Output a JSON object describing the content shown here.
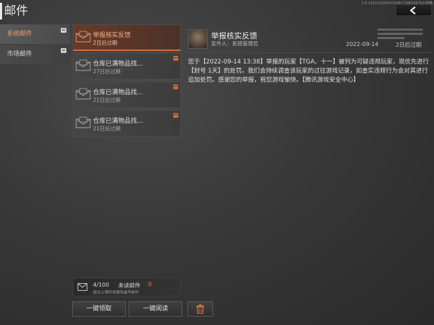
{
  "header": {
    "title": "邮件",
    "version": "1.0.116115(09141548)7186598763)高精"
  },
  "categories": [
    {
      "label": "系统邮件",
      "active": true
    },
    {
      "label": "市场邮件",
      "active": false
    }
  ],
  "mails": [
    {
      "title": "举报核实反馈",
      "expiry": "2日后过期",
      "active": true
    },
    {
      "title": "仓库已满物品找...",
      "expiry": "27日后过期",
      "active": false
    },
    {
      "title": "仓库已满物品找...",
      "expiry": "21日后过期",
      "active": false
    },
    {
      "title": "仓库已满物品找...",
      "expiry": "21日后过期",
      "active": false
    }
  ],
  "detail": {
    "title": "举报核实反馈",
    "sender": "发件人：系统管理员",
    "date": "2022-09-14",
    "expiry": "2日后过期",
    "body": "您于【2022-09-14 13:38】举报的玩家【TGA、十一】被列为可疑违规玩家，现优先进行【封号 1天】的处罚。我们会持续调查该玩家的过往游戏记录，如查实违规行为会对其进行追加处罚。感谢您的举报，祝您游戏愉快。【腾讯游戏安全中心】"
  },
  "footer": {
    "count": "4/100",
    "unread_label": "未读邮件",
    "unread_count": "0",
    "hint": "超出上限时将删除最早邮件",
    "claim_all": "一键领取",
    "read_all": "一键阅读"
  },
  "colors": {
    "accent": "#d66a3a",
    "active_text": "#f0a06e",
    "background": "#383838"
  },
  "icons": [
    "back-arrow-icon",
    "envelope-icon",
    "gift-badge-icon",
    "trash-icon"
  ]
}
